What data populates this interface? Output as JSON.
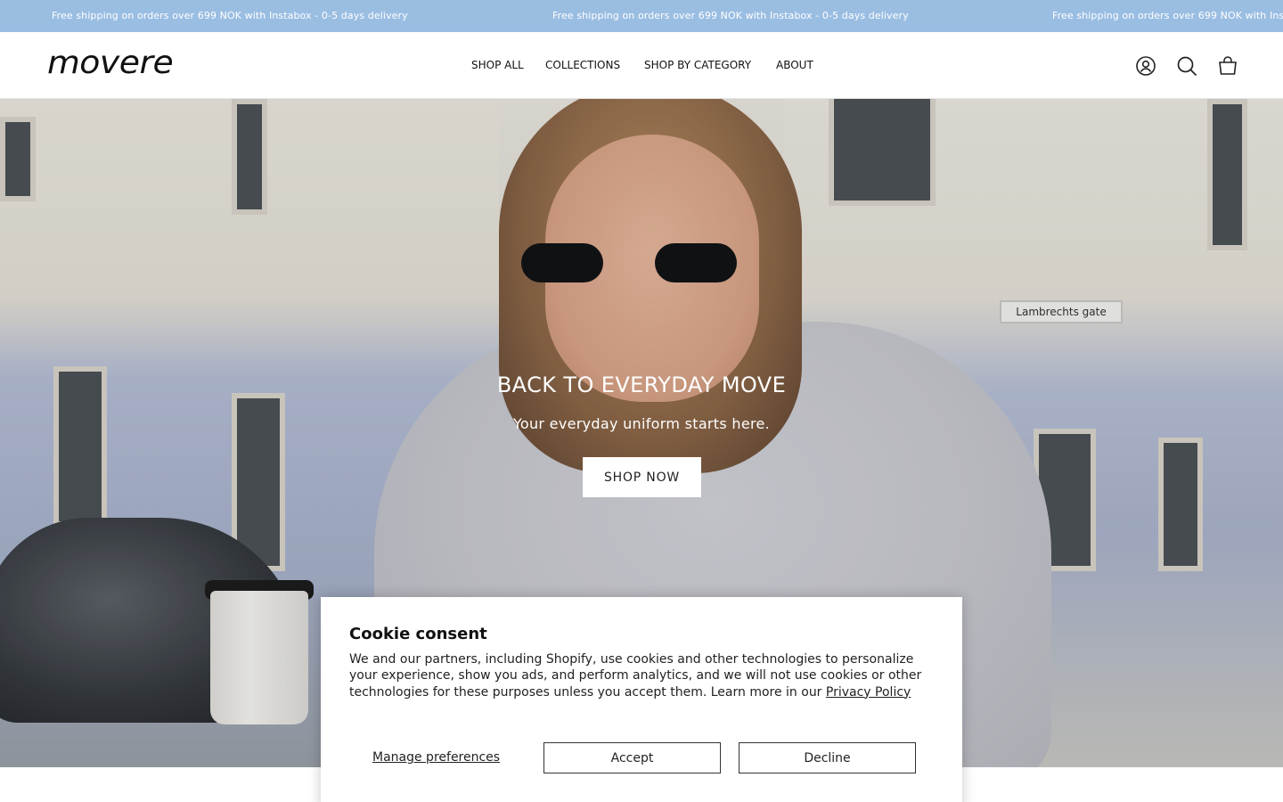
{
  "announcement": {
    "messages": [
      "Free shipping on orders over 699 NOK with Instabox - 0-5 days delivery",
      "Free shipping on orders over 699 NOK with Instabox - 0-5 days delivery",
      "Free shipping on orders over 699 NOK with Ins"
    ]
  },
  "header": {
    "logo": "movere",
    "nav": [
      "SHOP ALL",
      "COLLECTIONS",
      "SHOP BY CATEGORY",
      "ABOUT"
    ],
    "icons": [
      "account-icon",
      "search-icon",
      "cart-icon"
    ]
  },
  "hero": {
    "street_sign": "Lambrechts gate",
    "title": "BACK TO EVERYDAY MOVE",
    "subtitle": "Your everyday uniform starts here.",
    "button": "SHOP NOW"
  },
  "cookie": {
    "title": "Cookie consent",
    "body": "We and our partners, including Shopify, use cookies and other technologies to personalize your experience, show you ads, and perform analytics, and we will not use cookies or other technologies for these purposes unless you accept them. Learn more in our",
    "policy_link": "Privacy Policy",
    "manage": "Manage preferences",
    "accept": "Accept",
    "decline": "Decline"
  },
  "colors": {
    "announcement_bg": "#9abde2",
    "header_bg": "#ffffff",
    "button_bg": "#ffffff"
  }
}
